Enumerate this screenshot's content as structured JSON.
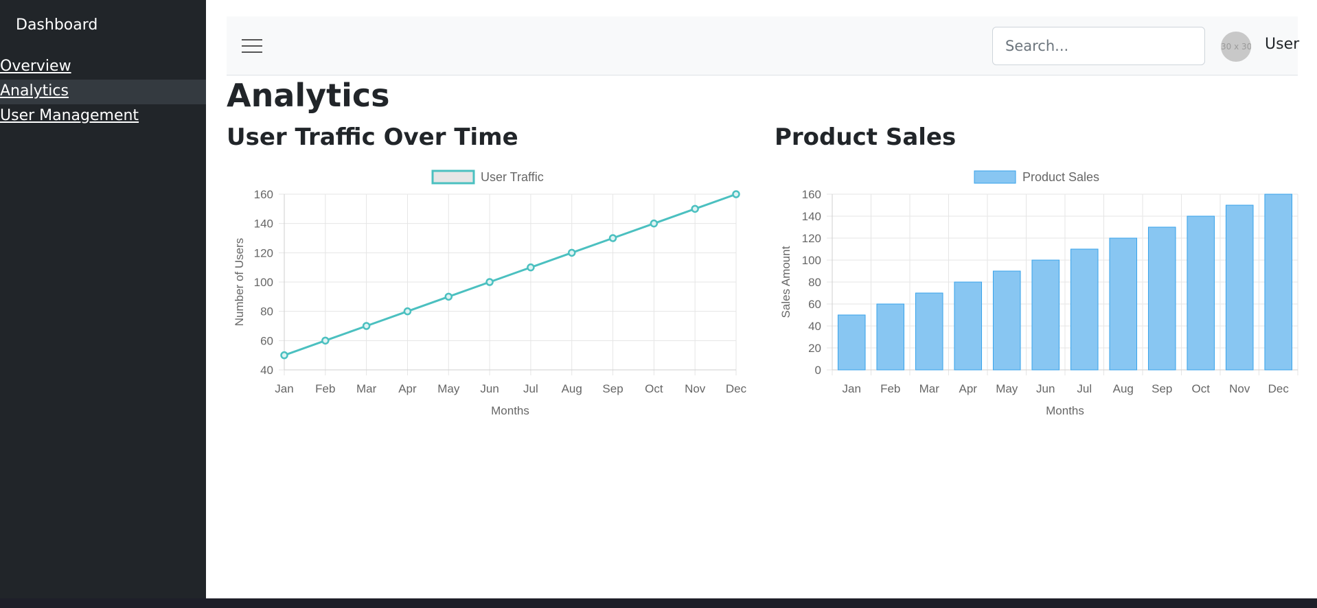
{
  "sidebar": {
    "brand": "Dashboard",
    "items": [
      {
        "label": "Overview",
        "active": false
      },
      {
        "label": "Analytics",
        "active": true
      },
      {
        "label": "User Management",
        "active": false
      }
    ]
  },
  "header": {
    "search_placeholder": "Search...",
    "avatar_placeholder": "30 x 30",
    "user_label": "User"
  },
  "main": {
    "title": "Analytics",
    "traffic_title": "User Traffic Over Time",
    "sales_title": "Product Sales"
  },
  "chart_data": [
    {
      "type": "line",
      "categories": [
        "Jan",
        "Feb",
        "Mar",
        "Apr",
        "May",
        "Jun",
        "Jul",
        "Aug",
        "Sep",
        "Oct",
        "Nov",
        "Dec"
      ],
      "series": [
        {
          "name": "User Traffic",
          "values": [
            50,
            60,
            70,
            80,
            90,
            100,
            110,
            120,
            130,
            140,
            150,
            160
          ]
        }
      ],
      "xlabel": "Months",
      "ylabel": "Number of Users",
      "ylim": [
        40,
        160
      ],
      "yticks": [
        40,
        60,
        80,
        100,
        120,
        140,
        160
      ],
      "grid": true,
      "legend": "top-center",
      "color": "#4bc0c0",
      "legend_fill": "#e6e6e6"
    },
    {
      "type": "bar",
      "categories": [
        "Jan",
        "Feb",
        "Mar",
        "Apr",
        "May",
        "Jun",
        "Jul",
        "Aug",
        "Sep",
        "Oct",
        "Nov",
        "Dec"
      ],
      "series": [
        {
          "name": "Product Sales",
          "values": [
            50,
            60,
            70,
            80,
            90,
            100,
            110,
            120,
            130,
            140,
            150,
            160
          ]
        }
      ],
      "xlabel": "Months",
      "ylabel": "Sales Amount",
      "ylim": [
        0,
        160
      ],
      "yticks": [
        0,
        20,
        40,
        60,
        80,
        100,
        120,
        140,
        160
      ],
      "grid": true,
      "legend": "top-center",
      "color": "#36a2eb",
      "fill": "#88c6f2"
    }
  ]
}
